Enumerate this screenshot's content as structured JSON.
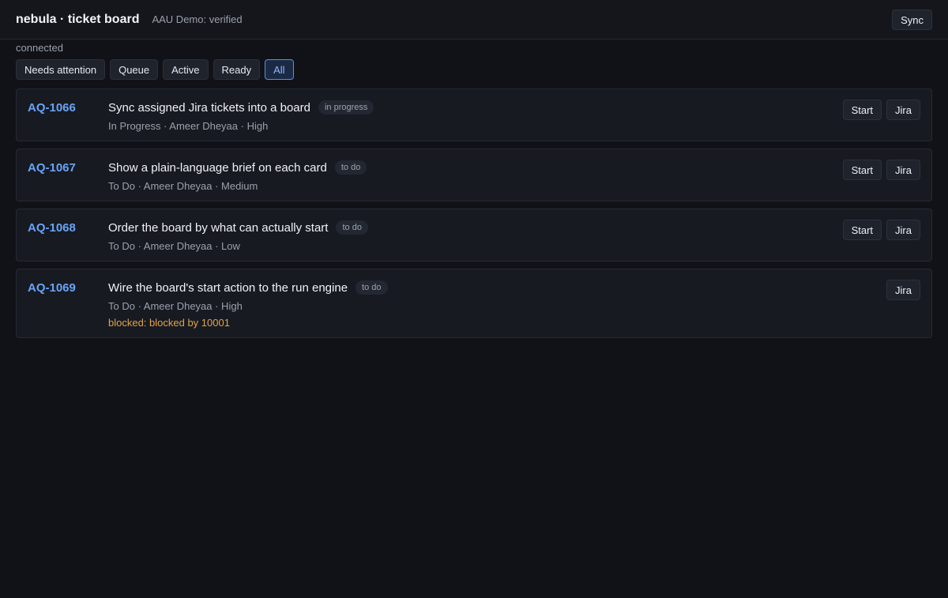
{
  "header": {
    "title": "nebula · ticket board",
    "subtitle": "AAU Demo: verified",
    "sync_label": "Sync"
  },
  "status": "connected",
  "filters": [
    {
      "label": "Needs attention",
      "active": false
    },
    {
      "label": "Queue",
      "active": false
    },
    {
      "label": "Active",
      "active": false
    },
    {
      "label": "Ready",
      "active": false
    },
    {
      "label": "All",
      "active": true
    }
  ],
  "tickets": [
    {
      "key": "AQ-1066",
      "title": "Sync assigned Jira tickets into a board",
      "badge": "in progress",
      "meta": "In Progress · Ameer Dheyaa · High",
      "start_label": "Start",
      "jira_label": "Jira"
    },
    {
      "key": "AQ-1067",
      "title": "Show a plain-language brief on each card",
      "badge": "to do",
      "meta": "To Do · Ameer Dheyaa · Medium",
      "start_label": "Start",
      "jira_label": "Jira"
    },
    {
      "key": "AQ-1068",
      "title": "Order the board by what can actually start",
      "badge": "to do",
      "meta": "To Do · Ameer Dheyaa · Low",
      "start_label": "Start",
      "jira_label": "Jira"
    },
    {
      "key": "AQ-1069",
      "title": "Wire the board's start action to the run engine",
      "badge": "to do",
      "meta": "To Do · Ameer Dheyaa · High",
      "blocked": "blocked: blocked by 10001",
      "jira_label": "Jira"
    }
  ]
}
